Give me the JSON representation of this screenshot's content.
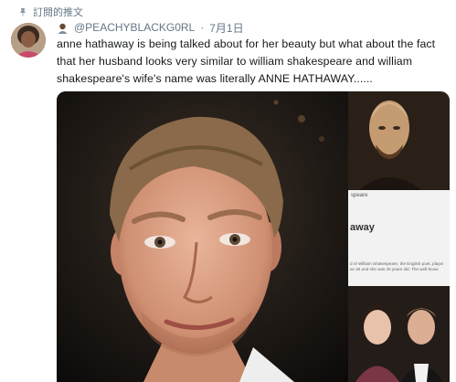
{
  "retweet_header": {
    "text": "訂閱的推文",
    "icon": "pin-icon"
  },
  "user": {
    "handle": "@PEACHYBLACKG0RL",
    "separator": "·",
    "date": "7月1日",
    "avatar": "avatar"
  },
  "tweet": {
    "text": "anne hathaway is being talked about for her beauty but what about the fact that her husband looks very similar to william shakespeare and william shakespeare's wife's name was literally ANNE HATHAWAY......"
  },
  "media": {
    "side_caption": "speare",
    "side_heading": "away",
    "side_body": "d of William Shakespeare, the English poet, playw as 26 and she was 26 years old. The well-know"
  }
}
